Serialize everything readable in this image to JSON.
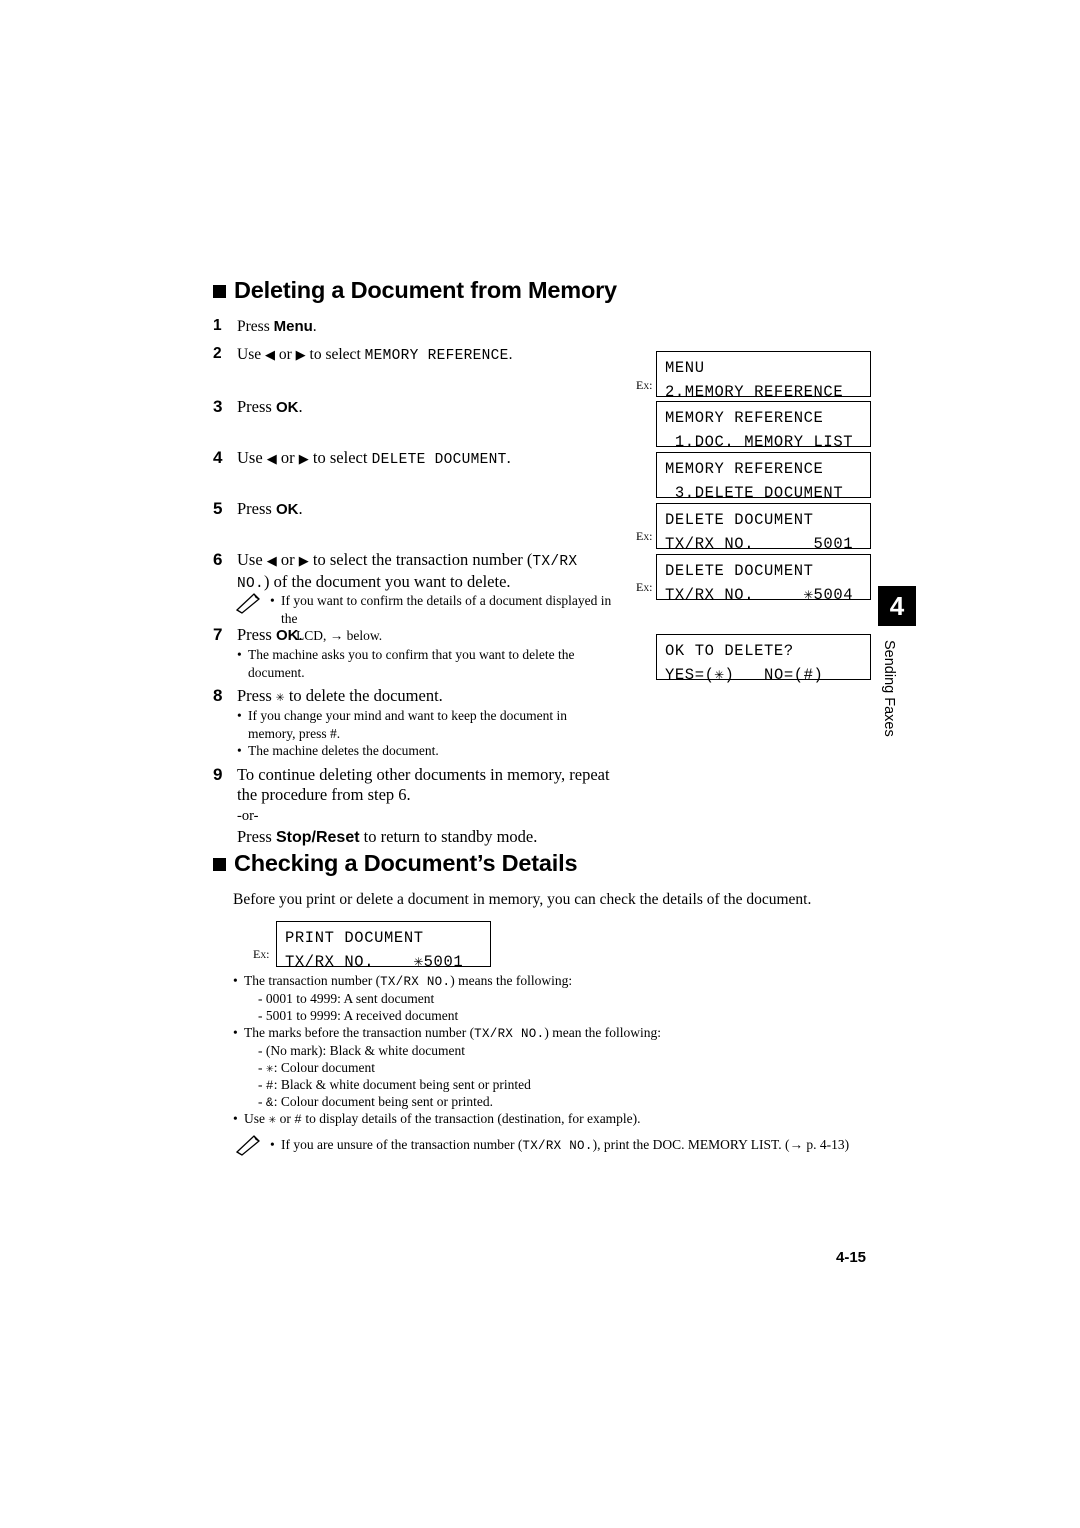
{
  "headings": {
    "h1": "Deleting a Document from Memory",
    "h2": "Checking a Document’s Details"
  },
  "steps": [
    {
      "num": "1",
      "text": "Press Menu."
    },
    {
      "num": "2",
      "text": "Use ◀ or ▶ to select MEMORY REFERENCE."
    },
    {
      "num": "3",
      "text": "Press OK."
    },
    {
      "num": "4",
      "text": "Use ◀ or ▶ to select DELETE DOCUMENT."
    },
    {
      "num": "5",
      "text": "Press OK."
    },
    {
      "num": "6",
      "text": "Use ◀ or ▶ to select the transaction number (TX/RX NO.) of the document you want to delete."
    },
    {
      "num": "7",
      "text": "Press OK."
    },
    {
      "num": "8",
      "text": "Press ✳ to delete the document."
    },
    {
      "num": "9",
      "text": "To continue deleting other documents in memory, repeat the procedure from step 6."
    }
  ],
  "step_labels": {
    "s1_press": "Press ",
    "s1_menu": "Menu",
    "s1_dot": ".",
    "s2_use": "Use ",
    "s2_or": " or ",
    "s2_select": " to select ",
    "s2_value": "MEMORY REFERENCE",
    "s2_dot": ".",
    "s3_press": "Press ",
    "s3_ok": "OK",
    "s3_dot": ".",
    "s4_use": "Use ",
    "s4_or": " or ",
    "s4_select": " to select ",
    "s4_value": "DELETE DOCUMENT",
    "s4_dot": ".",
    "s5_press": "Press ",
    "s5_ok": "OK",
    "s5_dot": ".",
    "s6_use": "Use ",
    "s6_or": " or ",
    "s6_select": " to select the transaction number (",
    "s6_value": "TX/RX",
    "s6_value2": "NO.",
    "s6_tail": ") of the document you want to delete.",
    "s7_press": "Press ",
    "s7_ok": "OK",
    "s7_dot": ".",
    "s8_press": "Press ",
    "s8_star": "✳",
    "s8_tail": " to delete the document.",
    "s9_line1": "To continue deleting other documents in memory, repeat",
    "s9_line2": "the procedure from step 6.",
    "s9_or": "-or-",
    "s9_press": "Press ",
    "s9_stopreset": "Stop/Reset",
    "s9_tail": " to return to standby mode."
  },
  "notes": {
    "note1_line1": "If you want to confirm the details of a document displayed in the",
    "note1_line2": "LCD, → below.",
    "note2": "The machine asks you to confirm that you want to delete the",
    "note2b": "document.",
    "note3": "If you change your mind and want to keep the document in",
    "note3b": "memory, press #.",
    "note4": "The machine deletes the document.",
    "note_final_a": "If you are unsure of the transaction number (",
    "note_final_mono": "TX/RX NO.",
    "note_final_b": "), print the DOC. MEMORY LIST. (→ p. 4-13)"
  },
  "lcds": [
    {
      "line1": "MENU",
      "line2": "2.MEMORY REFERENCE",
      "ex": true
    },
    {
      "line1": "MEMORY REFERENCE",
      "line2": " 1.DOC. MEMORY LIST",
      "ex": false
    },
    {
      "line1": "MEMORY REFERENCE",
      "line2": " 3.DELETE DOCUMENT",
      "ex": false
    },
    {
      "line1": "DELETE DOCUMENT",
      "line2": "TX/RX NO.      5001",
      "ex": true
    },
    {
      "line1": "DELETE DOCUMENT",
      "line2": "TX/RX NO.     ✳5004",
      "ex": true
    },
    {
      "line1": "OK TO DELETE?",
      "line2": "YES=(✳)   NO=(#)",
      "ex": false
    },
    {
      "line1": "PRINT DOCUMENT",
      "line2": "TX/RX NO.    ✳5001",
      "ex": true
    }
  ],
  "ex_label": "Ex:",
  "checking": {
    "intro": "Before you print or delete a document in memory, you can check the details of the document.",
    "b1_a": "The transaction number (",
    "b1_mono": "TX/RX NO.",
    "b1_b": ") means the following:",
    "b1_sub1": "0001 to 4999: A sent document",
    "b1_sub2": "5001 to 9999: A received document",
    "b2_a": "The marks before the transaction number (",
    "b2_mono": "TX/RX NO.",
    "b2_b": ") mean the following:",
    "b2_sub1": "(No mark): Black & white document",
    "b2_sub2_mono": "✳",
    "b2_sub2": ": Colour document",
    "b2_sub3_mono": "#",
    "b2_sub3": ": Black & white document being sent or printed",
    "b2_sub4_mono": "&",
    "b2_sub4": ": Colour document being sent or printed.",
    "b3_a": "Use ",
    "b3_mono1": "✳",
    "b3_mid": " or ",
    "b3_mono2": "#",
    "b3_b": " to display details of the transaction (destination, for example)."
  },
  "sidetab": {
    "number": "4",
    "label": "Sending Faxes"
  },
  "footer": {
    "page": "4-15"
  }
}
